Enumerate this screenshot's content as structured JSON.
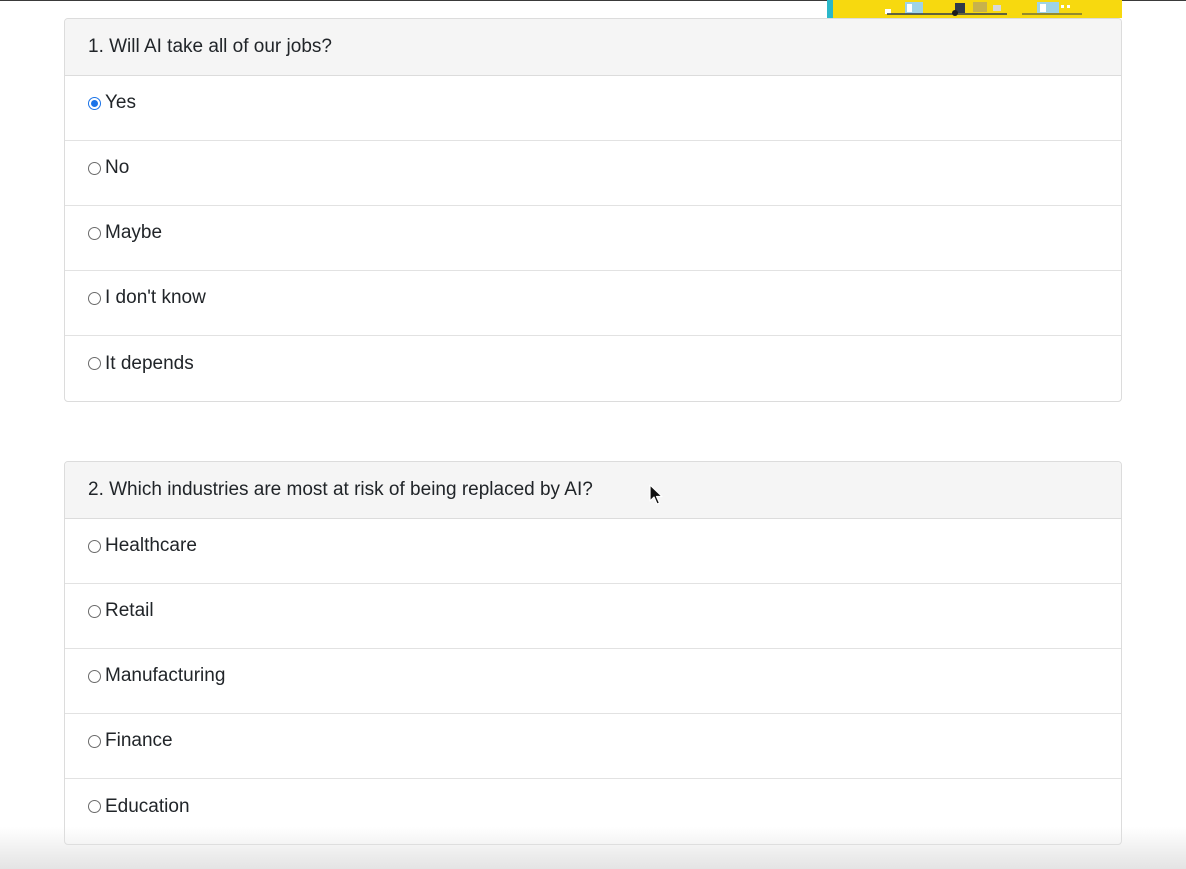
{
  "questions": [
    {
      "title": "1. Will AI take all of our jobs?",
      "options": [
        {
          "label": "Yes",
          "checked": true
        },
        {
          "label": "No",
          "checked": false
        },
        {
          "label": "Maybe",
          "checked": false
        },
        {
          "label": "I don't know",
          "checked": false
        },
        {
          "label": "It depends",
          "checked": false
        }
      ]
    },
    {
      "title": "2. Which industries are most at risk of being replaced by AI?",
      "options": [
        {
          "label": "Healthcare",
          "checked": false
        },
        {
          "label": "Retail",
          "checked": false
        },
        {
          "label": "Manufacturing",
          "checked": false
        },
        {
          "label": "Finance",
          "checked": false
        },
        {
          "label": "Education",
          "checked": false
        }
      ]
    }
  ],
  "colors": {
    "radio_checked": "#1a73e8",
    "banner": "#f7d90f",
    "header_bg": "#f5f5f5"
  }
}
